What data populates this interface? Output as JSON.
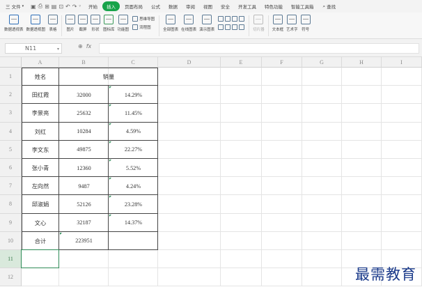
{
  "menubar": {
    "file_label": "三 文件",
    "tabs": [
      "开始",
      "插入",
      "页面布局",
      "公式",
      "数据",
      "审阅",
      "视图",
      "安全",
      "开发工具",
      "特色功能",
      "智能工具箱"
    ],
    "active_tab": "插入",
    "search_label": "查找"
  },
  "ribbon": {
    "buttons": [
      "数据透视表",
      "数据透视图",
      "表格",
      "图片",
      "截屏",
      "形状",
      "图标库",
      "功能图"
    ],
    "group1": [
      "思维导图",
      "流程图"
    ],
    "buttons2": [
      "全部图表",
      "在线图表",
      "演示图表"
    ],
    "disabled_button": "切片器",
    "buttons3": [
      "文本框",
      "艺术字",
      "符号"
    ]
  },
  "formula_bar": {
    "name_box": "N11",
    "fx": "fx",
    "value": ""
  },
  "sheet": {
    "columns": [
      "A",
      "B",
      "C",
      "D",
      "E",
      "F",
      "G",
      "H",
      "I"
    ],
    "rows": [
      "1",
      "2",
      "3",
      "4",
      "5",
      "6",
      "7",
      "8",
      "9",
      "10",
      "11",
      "12"
    ],
    "selected_row": "11",
    "header": {
      "name": "姓名",
      "sales": "销量"
    },
    "data": [
      {
        "name": "田红霞",
        "sales": "32000",
        "pct": "14.29%"
      },
      {
        "name": "李景亮",
        "sales": "25632",
        "pct": "11.45%"
      },
      {
        "name": "刘红",
        "sales": "10284",
        "pct": "4.59%"
      },
      {
        "name": "李文东",
        "sales": "49875",
        "pct": "22.27%"
      },
      {
        "name": "张小青",
        "sales": "12360",
        "pct": "5.52%"
      },
      {
        "name": "左向然",
        "sales": "9487",
        "pct": "4.24%"
      },
      {
        "name": "邱淑娟",
        "sales": "52126",
        "pct": "23.28%"
      },
      {
        "name": "文心",
        "sales": "32187",
        "pct": "14.37%"
      }
    ],
    "total": {
      "name": "合计",
      "sales": "223951",
      "pct": ""
    }
  },
  "watermark": "最需教育",
  "colors": {
    "accent": "#17a34a",
    "border": "#444444"
  }
}
